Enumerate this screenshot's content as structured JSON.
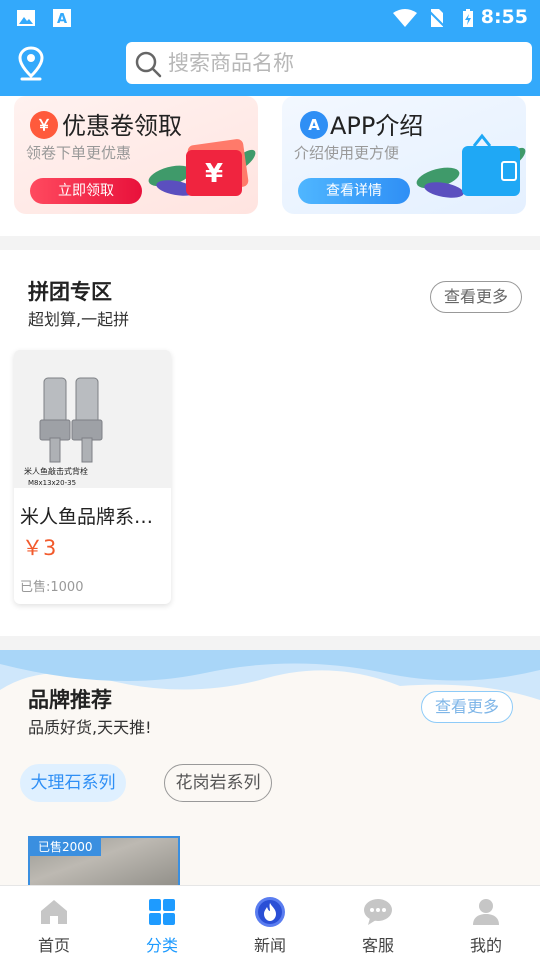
{
  "status_bar": {
    "time": "8:55"
  },
  "search": {
    "placeholder": "搜索商品名称"
  },
  "promos": [
    {
      "badge": "￥",
      "title": "优惠卷领取",
      "subtitle": "领卷下单更优惠",
      "button": "立即领取"
    },
    {
      "badge": "A",
      "title": "APP介绍",
      "subtitle": "介绍使用更方便",
      "button": "查看详情"
    }
  ],
  "group_buy": {
    "title": "拼团专区",
    "subtitle": "超划算,一起拼",
    "more": "查看更多",
    "products": [
      {
        "name": "米人鱼品牌系列膨胀螺栓",
        "price": "￥3",
        "sold": "已售:1000",
        "image_caption_line1": "米人鱼敲击式背栓",
        "image_caption_line2": "M8x13x20-35"
      }
    ]
  },
  "brand": {
    "title": "品牌推荐",
    "subtitle": "品质好货,天天推!",
    "more": "查看更多",
    "tabs": [
      "大理石系列",
      "花岗岩系列"
    ],
    "active_tab": 0,
    "item_sold": "已售2000"
  },
  "nav": {
    "items": [
      "首页",
      "分类",
      "新闻",
      "客服",
      "我的"
    ],
    "active": 1
  },
  "colors": {
    "primary": "#33a9fb",
    "active_nav": "#1e9bff",
    "price": "#f25a2c",
    "coupon_btn": "#e8113b"
  }
}
